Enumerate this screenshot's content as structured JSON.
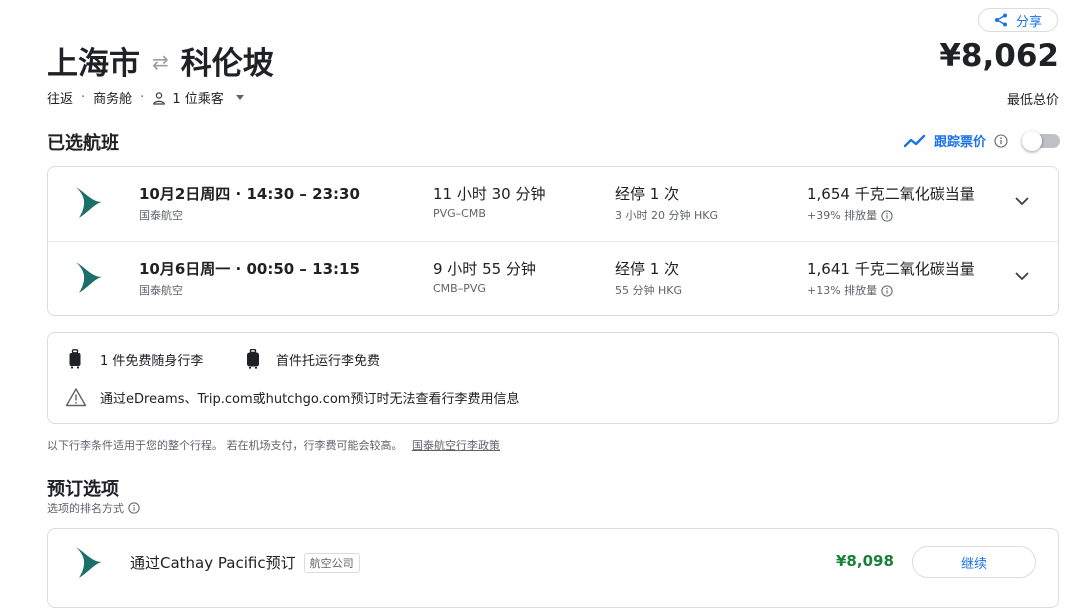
{
  "header": {
    "share_label": "分享",
    "origin": "上海市",
    "destination": "科伦坡",
    "total_price": "¥8,062",
    "price_label": "最低总价",
    "trip_type": "往返",
    "cabin_class": "商务舱",
    "passengers": "1 位乘客"
  },
  "selected": {
    "title": "已选航班",
    "track_label": "跟踪票价",
    "flights": [
      {
        "date_time": "10月2日周四 · 14:30 – 23:30",
        "airline": "国泰航空",
        "duration": "11 小时 30 分钟",
        "route": "PVG–CMB",
        "stops": "经停 1 次",
        "layover": "3 小时 20 分钟 HKG",
        "emissions": "1,654 千克二氧化碳当量",
        "emissions_delta": "+39% 排放量"
      },
      {
        "date_time": "10月6日周一 · 00:50 – 13:15",
        "airline": "国泰航空",
        "duration": "9 小时 55 分钟",
        "route": "CMB–PVG",
        "stops": "经停 1 次",
        "layover": "55 分钟 HKG",
        "emissions": "1,641 千克二氧化碳当量",
        "emissions_delta": "+13% 排放量"
      }
    ]
  },
  "baggage": {
    "carry_on": "1 件免费随身行李",
    "checked": "首件托运行李免费",
    "warning": "通过eDreams、Trip.com或hutchgo.com预订时无法查看行李费用信息",
    "note": "以下行李条件适用于您的整个行程。 若在机场支付，行李费可能会较高。",
    "policy_link": "国泰航空行李政策"
  },
  "booking": {
    "title": "预订选项",
    "sort_label": "选项的排名方式",
    "options": [
      {
        "name": "通过Cathay Pacific预订",
        "badge": "航空公司",
        "price": "¥8,098",
        "action": "继续"
      }
    ]
  },
  "colors": {
    "accent": "#1a73e8",
    "price_green": "#188038",
    "airline_teal": "#1b6e6a"
  }
}
